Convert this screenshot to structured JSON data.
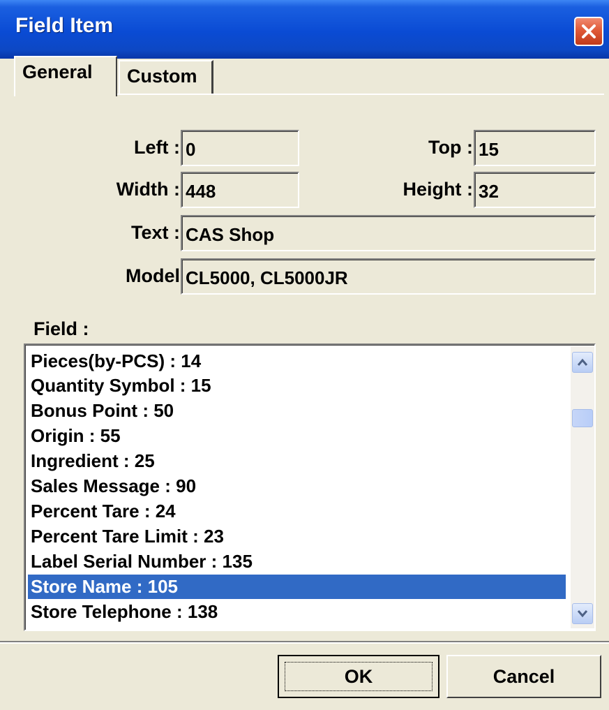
{
  "window": {
    "title": "Field Item"
  },
  "tabs": [
    {
      "label": "General",
      "active": true
    },
    {
      "label": "Custom",
      "active": false
    }
  ],
  "fields": {
    "left": {
      "label": "Left :",
      "value": "0"
    },
    "top": {
      "label": "Top :",
      "value": "15"
    },
    "width": {
      "label": "Width :",
      "value": "448"
    },
    "height": {
      "label": "Height :",
      "value": "32"
    },
    "text": {
      "label": "Text :",
      "value": "CAS Shop"
    },
    "model": {
      "label": "Model",
      "value": "CL5000, CL5000JR"
    }
  },
  "field_list": {
    "label": "Field :",
    "items": [
      "Pieces(by-PCS) : 14",
      "Quantity Symbol : 15",
      "Bonus Point : 50",
      "Origin : 55",
      "Ingredient : 25",
      "Sales Message : 90",
      "Percent Tare : 24",
      "Percent Tare Limit : 23",
      "Label Serial Number : 135",
      "Store Name : 105",
      "Store Telephone : 138"
    ],
    "selected_index": 9
  },
  "buttons": {
    "ok": "OK",
    "cancel": "Cancel"
  },
  "colors": {
    "titlebar": "#0a4bd4",
    "selection": "#316ac5",
    "dialog_bg": "#ece9d8"
  },
  "icons": {
    "close": "close-icon",
    "scroll_up": "chevron-up-icon",
    "scroll_down": "chevron-down-icon"
  }
}
